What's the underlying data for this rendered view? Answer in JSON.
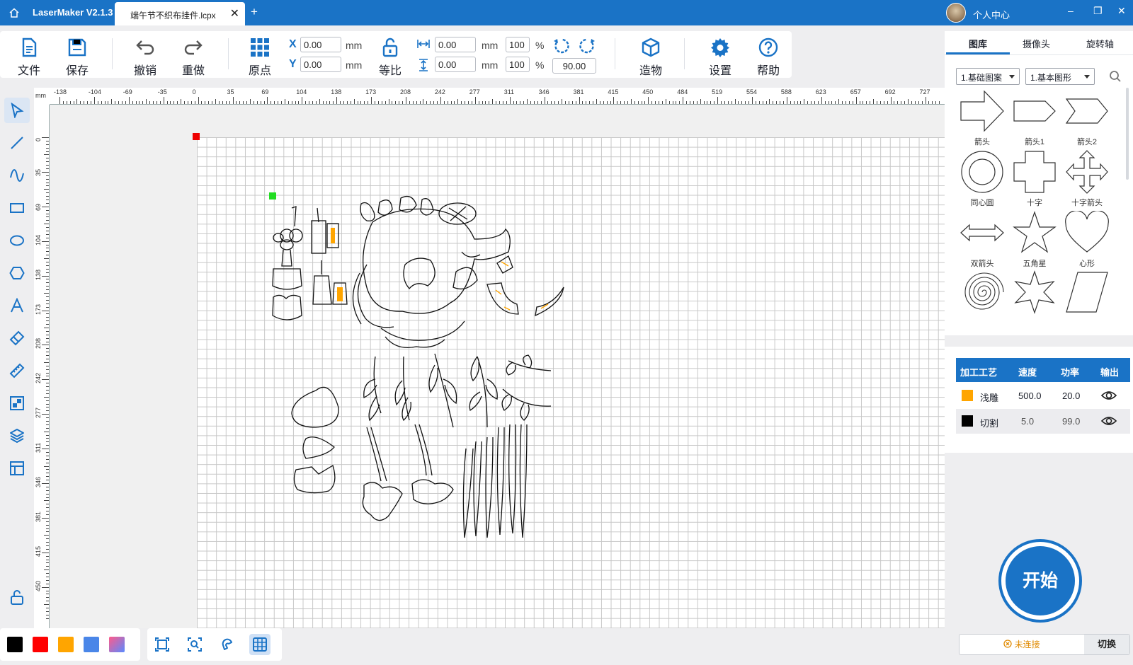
{
  "app": {
    "title": "LaserMaker V2.1.3",
    "document_tab": "端午节不织布挂件.lcpx",
    "new_tab": "+",
    "close": "✕",
    "user": "个人中心",
    "window_buttons": [
      "–",
      "❐",
      "✕"
    ]
  },
  "toolbar": {
    "file": "文件",
    "save": "保存",
    "undo": "撤销",
    "redo": "重做",
    "origin": "原点",
    "x_label": "X",
    "y_label": "Y",
    "x_value": "0.00",
    "y_value": "0.00",
    "unit_mm": "mm",
    "proportional": "等比",
    "width_value": "0.00",
    "height_value": "0.00",
    "width_percent": "100",
    "height_percent": "100",
    "percent": "%",
    "rotate_value": "90.00",
    "build": "造物",
    "settings": "设置",
    "help": "帮助"
  },
  "right_panel": {
    "tabs": [
      "图库",
      "摄像头",
      "旋转轴"
    ],
    "active_tab": 0,
    "category_select": "1.基础图案",
    "subcategory_select": "1.基本图形",
    "shapes": [
      "箭头",
      "箭头1",
      "箭头2",
      "同心圆",
      "十字",
      "十字箭头",
      "双箭头",
      "五角星",
      "心形",
      "",
      "",
      ""
    ]
  },
  "process_table": {
    "headers": [
      "加工工艺",
      "速度",
      "功率",
      "输出"
    ],
    "rows": [
      {
        "color": "#ffa500",
        "name": "浅雕",
        "speed": "500.0",
        "power": "20.0"
      },
      {
        "color": "#000000",
        "name": "切割",
        "speed": "5.0",
        "power": "99.0"
      }
    ]
  },
  "start_button": "开始",
  "connection": {
    "status": "未连接",
    "switch": "切换"
  },
  "ruler": {
    "unit": "mm",
    "top_ticks": [
      "-138",
      "-104",
      "-69",
      "-35",
      "0",
      "35",
      "69",
      "104",
      "138",
      "173",
      "208",
      "242",
      "277",
      "311",
      "346",
      "381",
      "415",
      "450",
      "484",
      "519",
      "554",
      "588",
      "623",
      "657",
      "692",
      "727"
    ],
    "left_ticks": [
      "0",
      "35",
      "69",
      "104",
      "138",
      "173",
      "208",
      "242",
      "277",
      "311",
      "346",
      "381",
      "415",
      "450"
    ]
  },
  "color_palette": [
    "#000000",
    "#ff0000",
    "#ffa500",
    "#4a86e8",
    "gradient"
  ],
  "colors": {
    "accent": "#1a73c6",
    "engrave": "#ffa500",
    "cut": "#000000"
  }
}
